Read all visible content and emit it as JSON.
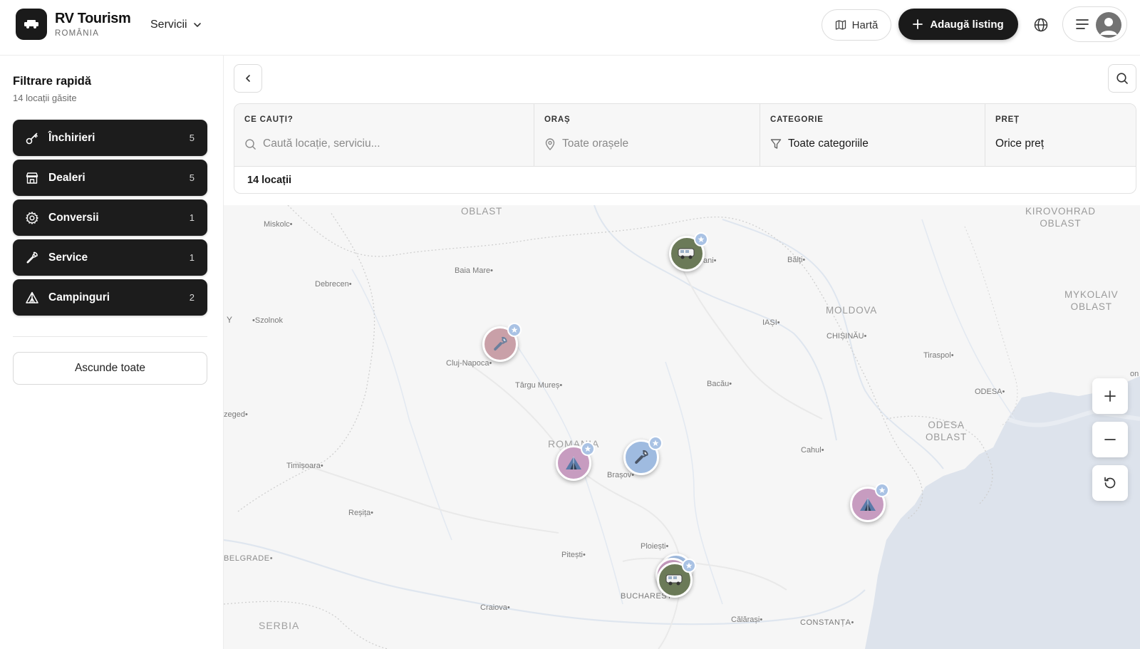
{
  "header": {
    "brand_title": "RV Tourism",
    "brand_subtitle": "ROMÂNIA",
    "services_label": "Servicii",
    "map_button": "Hartă",
    "add_listing_button": "Adaugă listing"
  },
  "sidebar": {
    "title": "Filtrare rapidă",
    "subtitle": "14 locații găsite",
    "categories": [
      {
        "label": "Închirieri",
        "count": "5",
        "icon": "key-icon"
      },
      {
        "label": "Dealeri",
        "count": "5",
        "icon": "store-icon"
      },
      {
        "label": "Conversii",
        "count": "1",
        "icon": "gear-icon"
      },
      {
        "label": "Service",
        "count": "1",
        "icon": "wrench-icon"
      },
      {
        "label": "Campinguri",
        "count": "2",
        "icon": "tent-icon"
      }
    ],
    "hide_all_button": "Ascunde toate"
  },
  "filters": {
    "what": {
      "label": "CE CAUȚI?",
      "placeholder": "Caută locație, serviciu..."
    },
    "city": {
      "label": "ORAȘ",
      "value": "Toate orașele"
    },
    "category": {
      "label": "CATEGORIE",
      "value": "Toate categoriile"
    },
    "price": {
      "label": "PREȚ",
      "value": "Orice preț"
    },
    "result_count": "14 locații"
  },
  "map": {
    "regions": {
      "oblast_top": "OBLAST",
      "kirovohrad": "KIROVOHRAD\nOBLAST",
      "moldova": "MOLDOVA",
      "mykolaiv": "MYKOLAIV\nOBLAST",
      "odesa_oblast": "ODESA\nOBLAST",
      "romania": "ROMANIA",
      "serbia": "SERBIA",
      "belgrade": "BELGRADE•"
    },
    "cities": {
      "miskolc": "Miskolc•",
      "debrecen": "Debrecen•",
      "szolnok": "•Szolnok",
      "baia_mare": "Baia Mare•",
      "cluj": "Cluj-Napoca•",
      "targu_mures": "Târgu Mureș•",
      "bacau": "Bacău•",
      "iasi": "IAȘI•",
      "chisinau": "CHIȘINĂU•",
      "balti": "Bălți•",
      "tiraspol": "Tiraspol•",
      "odesa": "ODESA•",
      "szeged": "zeged•",
      "timisoara": "Timișoara•",
      "resita": "Reșița•",
      "brasov": "Brașov•",
      "cahul": "Cahul•",
      "ploiesti": "Ploiești•",
      "pitesti": "Pitești•",
      "bucharest": "BUCHAREST",
      "craiova": "Craiova•",
      "calarasi": "Călărași•",
      "constanta": "CONSTANȚA•",
      "suceava_partial": "ani•",
      "y_partial": "Y",
      "on_partial": "on"
    },
    "markers": [
      {
        "type": "rv-icon",
        "color": "#6b7a58"
      },
      {
        "type": "wrench-icon",
        "color": "#c9a0a8"
      },
      {
        "type": "tent-icon",
        "color": "#c79cc0"
      },
      {
        "type": "wrench-icon",
        "color": "#9fbbe0"
      },
      {
        "type": "tent-icon",
        "color": "#c79cc0"
      },
      {
        "type": "rv-icon",
        "color": "#6b7a58"
      }
    ]
  }
}
